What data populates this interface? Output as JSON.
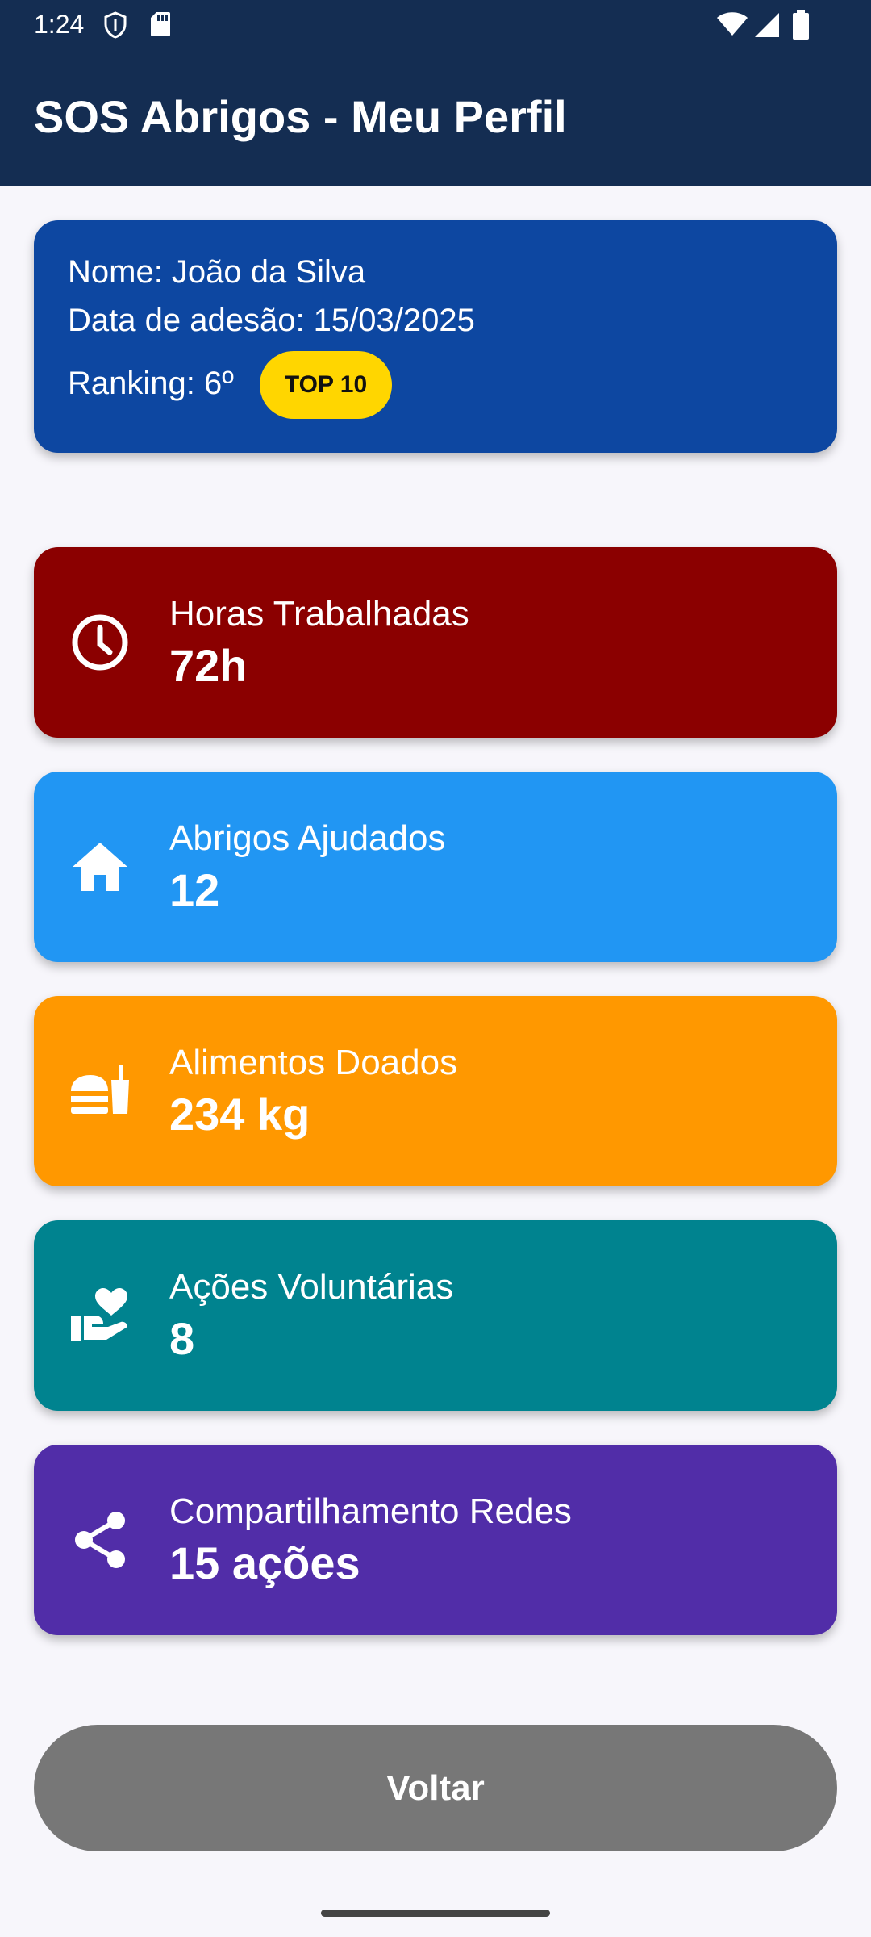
{
  "status_bar": {
    "time": "1:24",
    "icons": [
      "shield-icon",
      "sd-card-icon",
      "wifi-icon",
      "signal-icon",
      "battery-icon"
    ]
  },
  "app_bar": {
    "title": "SOS Abrigos - Meu Perfil",
    "background": "#142d52"
  },
  "profile": {
    "name": "Nome: João da Silva",
    "join_date": "Data de adesão: 15/03/2025",
    "ranking": "Ranking: 6º",
    "badge": "TOP 10",
    "background": "#0d47a1",
    "badge_color": "#ffd600"
  },
  "stats": [
    {
      "label": "Horas Trabalhadas",
      "value": "72h",
      "icon": "clock-icon",
      "color": "#8b0000"
    },
    {
      "label": "Abrigos Ajudados",
      "value": "12",
      "icon": "home-icon",
      "color": "#2196f3"
    },
    {
      "label": "Alimentos Doados",
      "value": "234 kg",
      "icon": "fastfood-icon",
      "color": "#ff9800"
    },
    {
      "label": "Ações Voluntárias",
      "value": "8",
      "icon": "volunteer-hand-heart-icon",
      "color": "#00838f"
    },
    {
      "label": "Compartilhamento Redes",
      "value": "15 ações",
      "icon": "share-icon",
      "color": "#512da8"
    }
  ],
  "back_button": {
    "label": "Voltar",
    "color": "#777777"
  }
}
